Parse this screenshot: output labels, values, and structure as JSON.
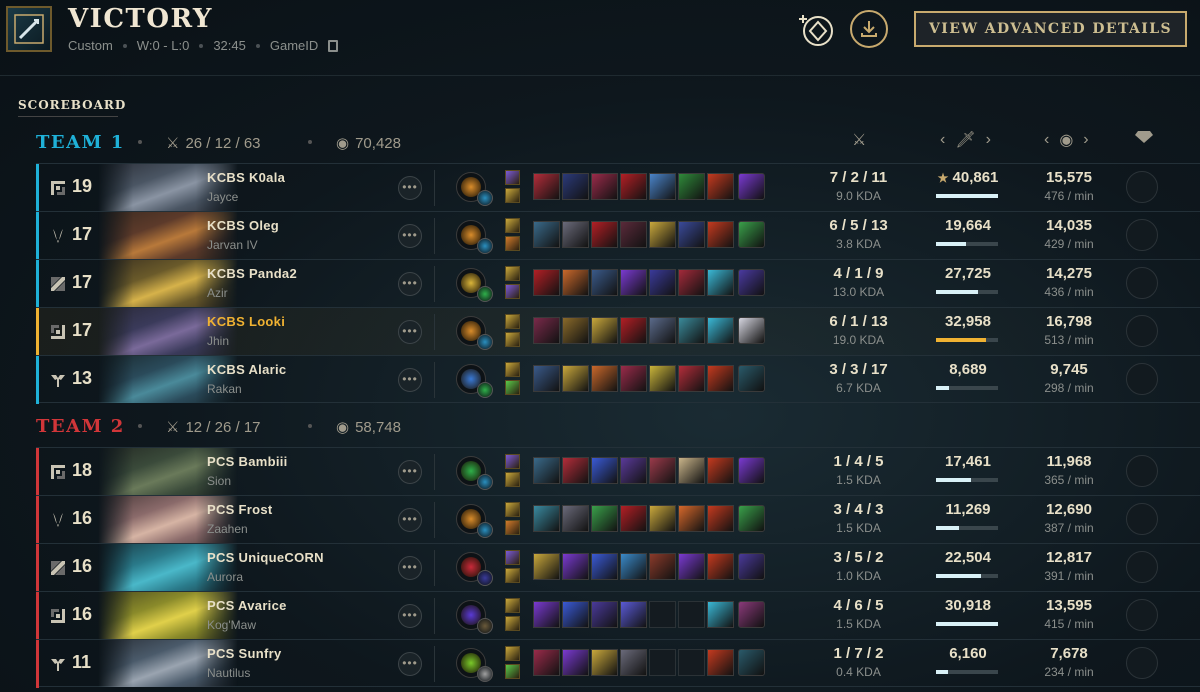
{
  "header": {
    "title": "VICTORY",
    "mode": "Custom",
    "record": "W:0 - L:0",
    "duration": "32:45",
    "game_id_label": "GameID",
    "advanced_button": "VIEW ADVANCED DETAILS"
  },
  "scoreboard_label": "SCOREBOARD",
  "colors": {
    "team1": "#1fb1d8",
    "team2": "#d13639",
    "gold_accent": "#c8aa6e",
    "self_highlight": "#f0b232"
  },
  "teams": [
    {
      "name": "TEAM 1",
      "kda": "26 / 12 / 63",
      "gold": "70,428",
      "players": [
        {
          "role_icon": "top-role-icon",
          "level": "19",
          "name": "KCBS K0ala",
          "champion": "Jayce",
          "kda": "7 / 2 / 11",
          "kda_ratio": "9.0 KDA",
          "damage": "40,861",
          "damage_star": true,
          "damage_share": 1.0,
          "gold": "15,575",
          "gold_per_min": "476 / min",
          "is_self": false,
          "portrait": [
            "#4a5563",
            "#8a94a3",
            "#2b2f38"
          ],
          "rune": "#d98c2b",
          "secondary": "#2a8fbf",
          "spells": [
            "#7b5bd6",
            "#c9a83c"
          ],
          "items": [
            "#b32d3a",
            "#2b3a7a",
            "#9a2b4a",
            "#b31f25",
            "#4a84c9",
            "#2f8a3a",
            "#c43a1f"
          ],
          "trinket": "#7a3ad1"
        },
        {
          "role_icon": "jungle-role-icon",
          "level": "17",
          "name": "KCBS Oleg",
          "champion": "Jarvan IV",
          "kda": "6 / 5 / 13",
          "kda_ratio": "3.8 KDA",
          "damage": "19,664",
          "damage_star": false,
          "damage_share": 0.48,
          "gold": "14,035",
          "gold_per_min": "429 / min",
          "is_self": false,
          "portrait": [
            "#5c3a2a",
            "#b8793a",
            "#3a2a20"
          ],
          "rune": "#d98c2b",
          "secondary": "#2a8fbf",
          "spells": [
            "#c9a83c",
            "#d17a2b"
          ],
          "items": [
            "#3a6a8a",
            "#6a6a7a",
            "#b31f25",
            "#5a2a3a",
            "#c9a83c",
            "#3a4a9a",
            "#c43a1f"
          ],
          "trinket": "#3aa04a"
        },
        {
          "role_icon": "mid-role-icon",
          "level": "17",
          "name": "KCBS Panda2",
          "champion": "Azir",
          "kda": "4 / 1 / 9",
          "kda_ratio": "13.0 KDA",
          "damage": "27,725",
          "damage_star": false,
          "damage_share": 0.68,
          "gold": "14,275",
          "gold_per_min": "436 / min",
          "is_self": false,
          "portrait": [
            "#6a5a2a",
            "#d6b24a",
            "#3a3020"
          ],
          "rune": "#d9b43a",
          "secondary": "#2fb04a",
          "spells": [
            "#c9a83c",
            "#7b5bd6"
          ],
          "items": [
            "#b31f25",
            "#c9682b",
            "#3a5a8a",
            "#7a3ad1",
            "#3a3a9a",
            "#a32a3a",
            "#3ab8d6"
          ],
          "trinket": "#4a3aa0"
        },
        {
          "role_icon": "bottom-role-icon",
          "level": "17",
          "name": "KCBS Looki",
          "champion": "Jhin",
          "kda": "6 / 1 / 13",
          "kda_ratio": "19.0 KDA",
          "damage": "32,958",
          "damage_star": false,
          "damage_share": 0.81,
          "gold": "16,798",
          "gold_per_min": "513 / min",
          "is_self": true,
          "portrait": [
            "#3a3a5a",
            "#7a6a9a",
            "#2a2a38"
          ],
          "rune": "#d98c2b",
          "secondary": "#2a8fbf",
          "spells": [
            "#c9a83c",
            "#c9a83c"
          ],
          "items": [
            "#7a2a4a",
            "#8a6a2a",
            "#c9a83c",
            "#b31f25",
            "#5a6a8a",
            "#3a8a9a",
            "#3ab8d6"
          ],
          "trinket": "#d6d6e0"
        },
        {
          "role_icon": "support-role-icon",
          "level": "13",
          "name": "KCBS Alaric",
          "champion": "Rakan",
          "kda": "3 / 3 / 17",
          "kda_ratio": "6.7 KDA",
          "damage": "8,689",
          "damage_star": false,
          "damage_share": 0.21,
          "gold": "9,745",
          "gold_per_min": "298 / min",
          "is_self": false,
          "portrait": [
            "#2a4a5a",
            "#4a8a9a",
            "#1a2a30"
          ],
          "rune": "#3a7ad6",
          "secondary": "#2fb04a",
          "spells": [
            "#c9a83c",
            "#5ac94a"
          ],
          "items": [
            "#3a5a8a",
            "#c9a83c",
            "#c9682b",
            "#9a2b4a",
            "#c9b43a",
            "#b32d3a",
            "#c43a1f"
          ],
          "trinket": "#2a5a6a"
        }
      ]
    },
    {
      "name": "TEAM 2",
      "kda": "12 / 26 / 17",
      "gold": "58,748",
      "players": [
        {
          "role_icon": "top-role-icon",
          "level": "18",
          "name": "PCS Bambiii",
          "champion": "Sion",
          "kda": "1 / 4 / 5",
          "kda_ratio": "1.5 KDA",
          "damage": "17,461",
          "damage_star": false,
          "damage_share": 0.57,
          "gold": "11,968",
          "gold_per_min": "365 / min",
          "is_self": false,
          "portrait": [
            "#3a4a3a",
            "#6a7a5a",
            "#242a24"
          ],
          "rune": "#2fb04a",
          "secondary": "#2a8fbf",
          "spells": [
            "#7b5bd6",
            "#c9a83c"
          ],
          "items": [
            "#3a6a8a",
            "#b32d3a",
            "#3a5ad6",
            "#5a3a9a",
            "#9a3a4a",
            "#c9b48a",
            "#c43a1f"
          ],
          "trinket": "#7a3ad1"
        },
        {
          "role_icon": "jungle-role-icon",
          "level": "16",
          "name": "PCS Frost",
          "champion": "Zaahen",
          "kda": "3 / 4 / 3",
          "kda_ratio": "1.5 KDA",
          "damage": "11,269",
          "damage_star": false,
          "damage_share": 0.37,
          "gold": "12,690",
          "gold_per_min": "387 / min",
          "is_self": false,
          "portrait": [
            "#8a6a6a",
            "#d6b4a4",
            "#4a3a3a"
          ],
          "rune": "#d98c2b",
          "secondary": "#2a8fbf",
          "spells": [
            "#c9a83c",
            "#d17a2b"
          ],
          "items": [
            "#3a8aa0",
            "#6a6a7a",
            "#3aa04a",
            "#b31f25",
            "#c9a83c",
            "#d6682b",
            "#c43a1f"
          ],
          "trinket": "#3aa04a"
        },
        {
          "role_icon": "mid-role-icon",
          "level": "16",
          "name": "PCS UniqueCORN",
          "champion": "Aurora",
          "kda": "3 / 5 / 2",
          "kda_ratio": "1.0 KDA",
          "damage": "22,504",
          "damage_star": false,
          "damage_share": 0.73,
          "gold": "12,817",
          "gold_per_min": "391 / min",
          "is_self": false,
          "portrait": [
            "#2a7a8a",
            "#4ab8c9",
            "#1a3a44"
          ],
          "rune": "#c92a3a",
          "secondary": "#3a3a9a",
          "spells": [
            "#7b5bd6",
            "#c9a83c"
          ],
          "items": [
            "#c9a83c",
            "#7a3ad1",
            "#3a5ad6",
            "#3a8ac9",
            "#8a3a2a",
            "#7a3ad1",
            "#c43a1f"
          ],
          "trinket": "#4a3a9a"
        },
        {
          "role_icon": "bottom-role-icon",
          "level": "16",
          "name": "PCS Avarice",
          "champion": "Kog'Maw",
          "kda": "4 / 6 / 5",
          "kda_ratio": "1.5 KDA",
          "damage": "30,918",
          "damage_star": false,
          "damage_share": 1.0,
          "gold": "13,595",
          "gold_per_min": "415 / min",
          "is_self": false,
          "portrait": [
            "#8a8a2a",
            "#e0d04a",
            "#4a4a20"
          ],
          "rune": "#5a3ad6",
          "secondary": "#6a5a3a",
          "spells": [
            "#c9a83c",
            "#c9a83c"
          ],
          "items": [
            "#7a3ad1",
            "#3a5ad6",
            "#4a3a9a",
            "#5a5ad6",
            null,
            null,
            "#3ab8d6"
          ],
          "trinket": "#8a3a7a"
        },
        {
          "role_icon": "support-role-icon",
          "level": "11",
          "name": "PCS Sunfry",
          "champion": "Nautilus",
          "kda": "1 / 7 / 2",
          "kda_ratio": "0.4 KDA",
          "damage": "6,160",
          "damage_star": false,
          "damage_share": 0.2,
          "gold": "7,678",
          "gold_per_min": "234 / min",
          "is_self": false,
          "portrait": [
            "#4a5a6a",
            "#9aa4b0",
            "#2a3038"
          ],
          "rune": "#7ac92a",
          "secondary": "#a0a0a0",
          "spells": [
            "#c9a83c",
            "#5ac94a"
          ],
          "items": [
            "#9a2b4a",
            "#7a3ad1",
            "#c9a83c",
            "#6a6a7a",
            null,
            null,
            "#c43a1f"
          ],
          "trinket": "#2a5a6a"
        }
      ]
    }
  ]
}
